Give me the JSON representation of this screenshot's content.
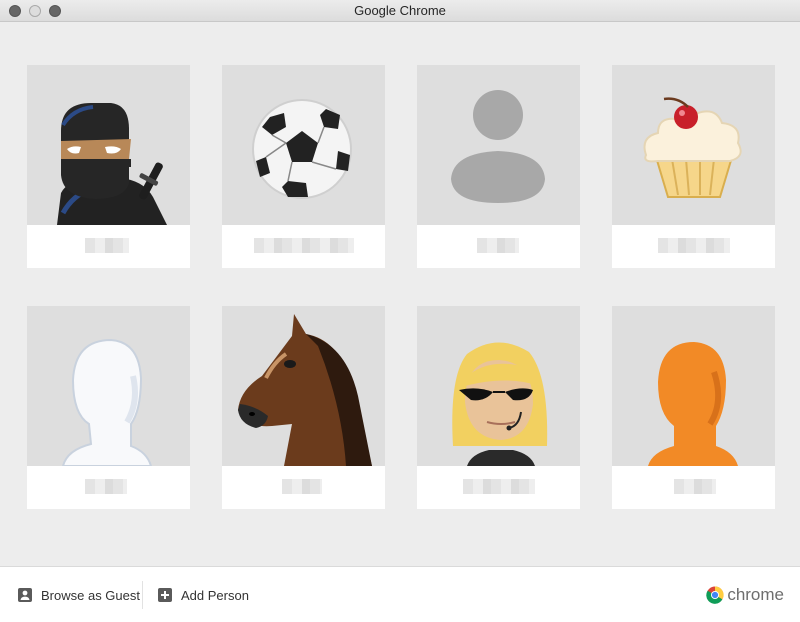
{
  "window": {
    "title": "Google Chrome"
  },
  "profiles": [
    {
      "avatar": "ninja-avatar",
      "name": ""
    },
    {
      "avatar": "soccer-ball-avatar",
      "name": ""
    },
    {
      "avatar": "generic-person-avatar",
      "name": ""
    },
    {
      "avatar": "cupcake-avatar",
      "name": ""
    },
    {
      "avatar": "white-head-avatar",
      "name": ""
    },
    {
      "avatar": "horse-avatar",
      "name": ""
    },
    {
      "avatar": "blonde-woman-avatar",
      "name": ""
    },
    {
      "avatar": "orange-head-avatar",
      "name": ""
    }
  ],
  "footer": {
    "guest_label": "Browse as Guest",
    "add_label": "Add Person",
    "brand": "chrome"
  },
  "colors": {
    "card_bg": "#dedede",
    "window_bg": "#ededed"
  }
}
